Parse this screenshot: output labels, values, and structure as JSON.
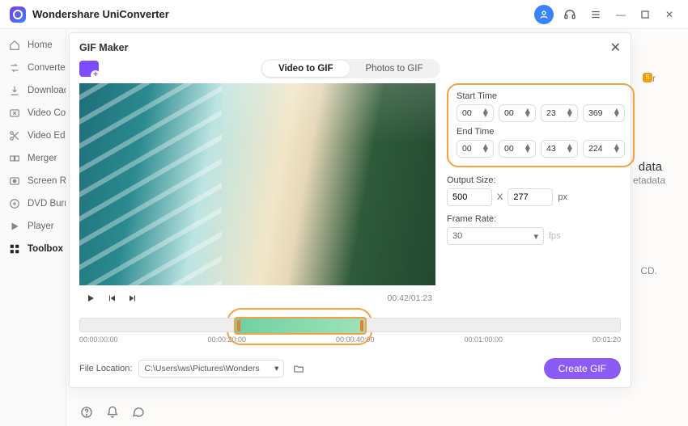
{
  "titlebar": {
    "brand": "Wondershare UniConverter"
  },
  "sidebar": {
    "items": [
      {
        "label": "Home"
      },
      {
        "label": "Converter"
      },
      {
        "label": "Downloader"
      },
      {
        "label": "Video Compressor"
      },
      {
        "label": "Video Editor"
      },
      {
        "label": "Merger"
      },
      {
        "label": "Screen Recorder"
      },
      {
        "label": "DVD Burner"
      },
      {
        "label": "Player"
      },
      {
        "label": "Toolbox"
      }
    ]
  },
  "bg": {
    "tor_label": "tor",
    "data": "data",
    "metadata": "etadata",
    "cd": "CD."
  },
  "modal": {
    "title": "GIF Maker",
    "tabs": {
      "video": "Video to GIF",
      "photos": "Photos to GIF"
    },
    "time_current": "00:42/01:23",
    "start_label": "Start Time",
    "end_label": "End Time",
    "start": {
      "h": "00",
      "m": "00",
      "s": "23",
      "ms": "369"
    },
    "end": {
      "h": "00",
      "m": "00",
      "s": "43",
      "ms": "224"
    },
    "output_size_label": "Output Size:",
    "output_w": "500",
    "output_x": "X",
    "output_h": "277",
    "output_unit": "px",
    "frame_rate_label": "Frame Rate:",
    "frame_rate": "30",
    "fps_unit": "fps",
    "timeline_ticks": [
      "00:00:00:00",
      "00:00:20:00",
      "00:00:40:00",
      "00:01:00:00",
      "00:01:20"
    ],
    "file_location_label": "File Location:",
    "file_location": "C:\\Users\\ws\\Pictures\\Wonders",
    "create_label": "Create GIF"
  }
}
